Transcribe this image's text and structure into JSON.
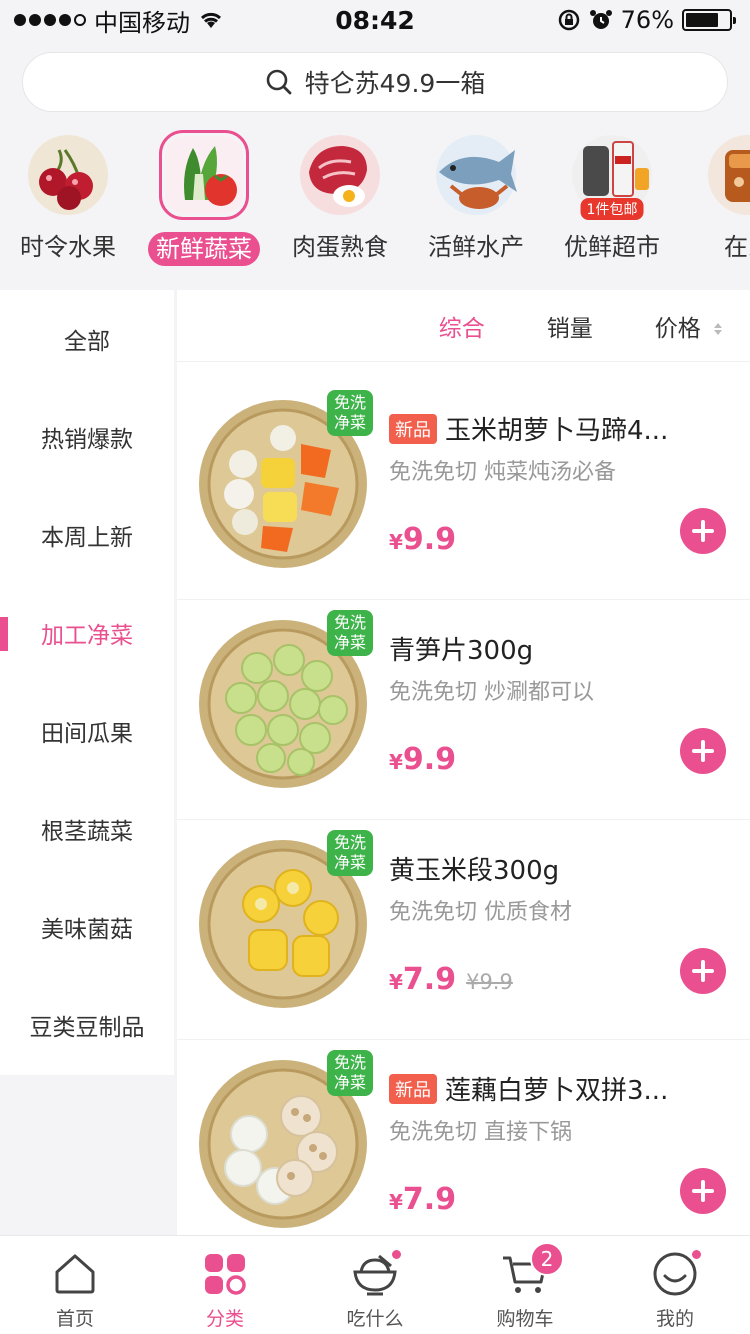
{
  "status_bar": {
    "carrier": "中国移动",
    "time": "08:42",
    "battery": "76%",
    "battery_level": 0.76
  },
  "search": {
    "placeholder": "特仑苏49.9一箱"
  },
  "categories": [
    {
      "label": "时令水果",
      "icon": "cherry-icon",
      "active": false
    },
    {
      "label": "新鲜蔬菜",
      "icon": "vegetable-icon",
      "active": true
    },
    {
      "label": "肉蛋熟食",
      "icon": "meat-egg-icon",
      "active": false
    },
    {
      "label": "活鲜水产",
      "icon": "fish-crab-icon",
      "active": false
    },
    {
      "label": "优鲜超市",
      "icon": "supermarket-icon",
      "active": false,
      "badge": "1件包邮"
    },
    {
      "label": "在家",
      "icon": "drink-icon",
      "active": false
    }
  ],
  "sidebar": {
    "items": [
      {
        "label": "全部",
        "active": false
      },
      {
        "label": "热销爆款",
        "active": false
      },
      {
        "label": "本周上新",
        "active": false
      },
      {
        "label": "加工净菜",
        "active": true
      },
      {
        "label": "田间瓜果",
        "active": false
      },
      {
        "label": "根茎蔬菜",
        "active": false
      },
      {
        "label": "美味菌菇",
        "active": false
      },
      {
        "label": "豆类豆制品",
        "active": false
      }
    ]
  },
  "sort": {
    "comprehensive": "综合",
    "sales": "销量",
    "price": "价格"
  },
  "products": [
    {
      "tag": "免洗净菜",
      "new_label": "新品",
      "title": "玉米胡萝卜马蹄4...",
      "subtitle": "免洗免切 炖菜炖汤必备",
      "price_symbol": "¥",
      "price": "9.9",
      "old_price": ""
    },
    {
      "tag": "免洗净菜",
      "new_label": "",
      "title": "青笋片300g",
      "subtitle": "免洗免切 炒涮都可以",
      "price_symbol": "¥",
      "price": "9.9",
      "old_price": ""
    },
    {
      "tag": "免洗净菜",
      "new_label": "",
      "title": "黄玉米段300g",
      "subtitle": "免洗免切 优质食材",
      "price_symbol": "¥",
      "price": "7.9",
      "old_price": "¥9.9"
    },
    {
      "tag": "免洗净菜",
      "new_label": "新品",
      "title": "莲藕白萝卜双拼3...",
      "subtitle": "免洗免切 直接下锅",
      "price_symbol": "¥",
      "price": "7.9",
      "old_price": ""
    }
  ],
  "tabbar": {
    "home": "首页",
    "category": "分类",
    "eat": "吃什么",
    "cart": "购物车",
    "cart_count": "2",
    "mine": "我的"
  },
  "colors": {
    "accent": "#ea4f8f",
    "clean_tag": "#3db34a",
    "new_tag": "#f25f4c"
  }
}
